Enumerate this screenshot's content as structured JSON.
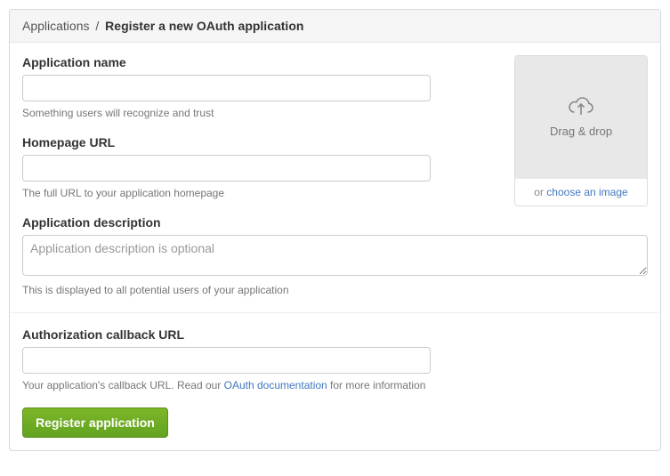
{
  "breadcrumb": {
    "parent": "Applications",
    "separator": "/",
    "current": "Register a new OAuth application"
  },
  "fields": {
    "app_name": {
      "label": "Application name",
      "value": "",
      "hint": "Something users will recognize and trust"
    },
    "homepage_url": {
      "label": "Homepage URL",
      "value": "",
      "hint": "The full URL to your application homepage"
    },
    "description": {
      "label": "Application description",
      "placeholder": "Application description is optional",
      "value": "",
      "hint": "This is displayed to all potential users of your application"
    },
    "callback_url": {
      "label": "Authorization callback URL",
      "value": "",
      "hint_prefix": "Your application's callback URL. Read our ",
      "hint_link": "OAuth documentation",
      "hint_suffix": " for more information"
    }
  },
  "uploader": {
    "drop_text": "Drag & drop",
    "or_text": "or ",
    "choose_link": "choose an image"
  },
  "submit": {
    "label": "Register application"
  }
}
